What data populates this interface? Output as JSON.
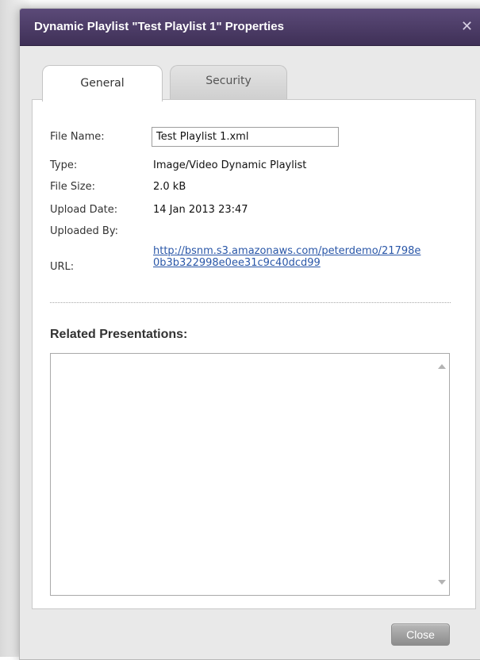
{
  "dialog": {
    "title": "Dynamic Playlist \"Test Playlist 1\" Properties",
    "close_glyph": "✕"
  },
  "tabs": [
    {
      "label": "General",
      "active": true
    },
    {
      "label": "Security",
      "active": false
    }
  ],
  "general": {
    "file_name_label": "File Name:",
    "file_name_value": "Test Playlist 1.xml",
    "type_label": "Type:",
    "type_value": "Image/Video Dynamic Playlist",
    "file_size_label": "File Size:",
    "file_size_value": "2.0 kB",
    "upload_date_label": "Upload Date:",
    "upload_date_value": "14 Jan 2013 23:47",
    "uploaded_by_label": "Uploaded By:",
    "uploaded_by_value": "",
    "url_label": "URL:",
    "url_value": "http://bsnm.s3.amazonaws.com/peterdemo/21798e0b3b322998e0ee31c9c40dcd99"
  },
  "related": {
    "title": "Related Presentations:",
    "items": []
  },
  "footer": {
    "close_label": "Close"
  },
  "colors": {
    "titlebar": "#4b3b66",
    "link": "#2a57a8",
    "button": "#a3a3a3"
  }
}
